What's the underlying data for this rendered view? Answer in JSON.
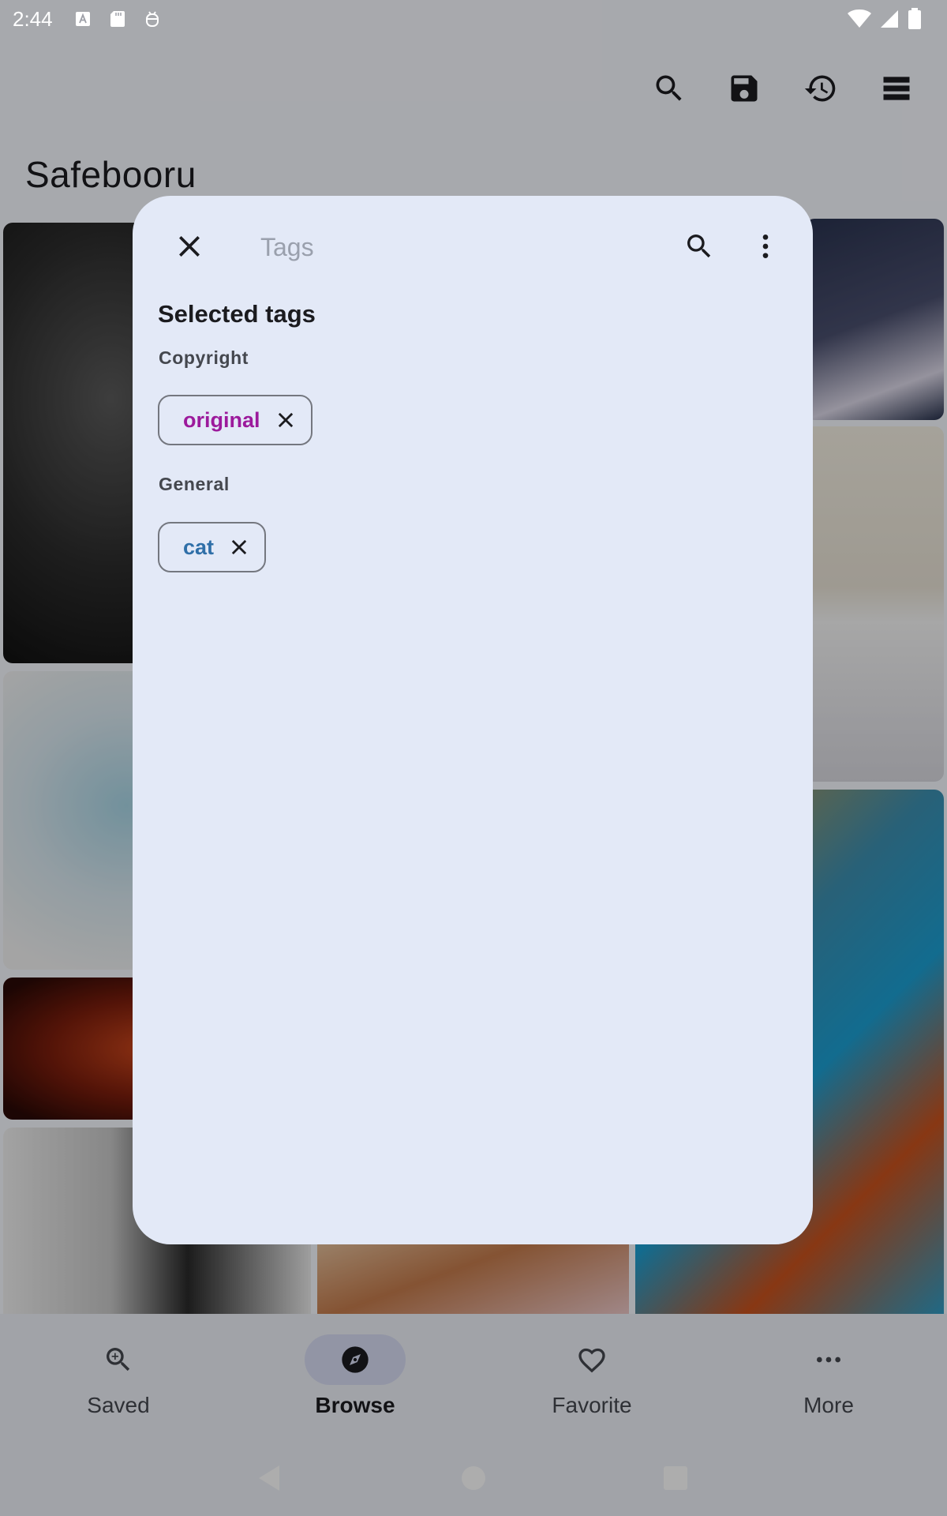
{
  "status_bar": {
    "time": "2:44"
  },
  "app_bar": {
    "title": "Safebooru",
    "actions": [
      "search-icon",
      "save-icon",
      "history-icon",
      "list-icon"
    ]
  },
  "dialog": {
    "search_placeholder": "Tags",
    "search_value": "",
    "heading": "Selected tags",
    "groups": [
      {
        "label": "Copyright",
        "tags": [
          {
            "text": "original",
            "color": "#9c1a9c"
          }
        ]
      },
      {
        "label": "General",
        "tags": [
          {
            "text": "cat",
            "color": "#2f6fa8"
          }
        ]
      }
    ]
  },
  "bottom_nav": {
    "items": [
      {
        "label": "Saved",
        "icon": "saved-search-icon",
        "active": false
      },
      {
        "label": "Browse",
        "icon": "compass-icon",
        "active": true
      },
      {
        "label": "Favorite",
        "icon": "heart-icon",
        "active": false
      },
      {
        "label": "More",
        "icon": "more-horizontal-icon",
        "active": false
      }
    ]
  },
  "colors": {
    "dialog_background": "#e3e9f7",
    "copyright_tag": "#9c1a9c",
    "general_tag": "#2f6fa8",
    "nav_active_indicator": "#d8dcf4"
  }
}
